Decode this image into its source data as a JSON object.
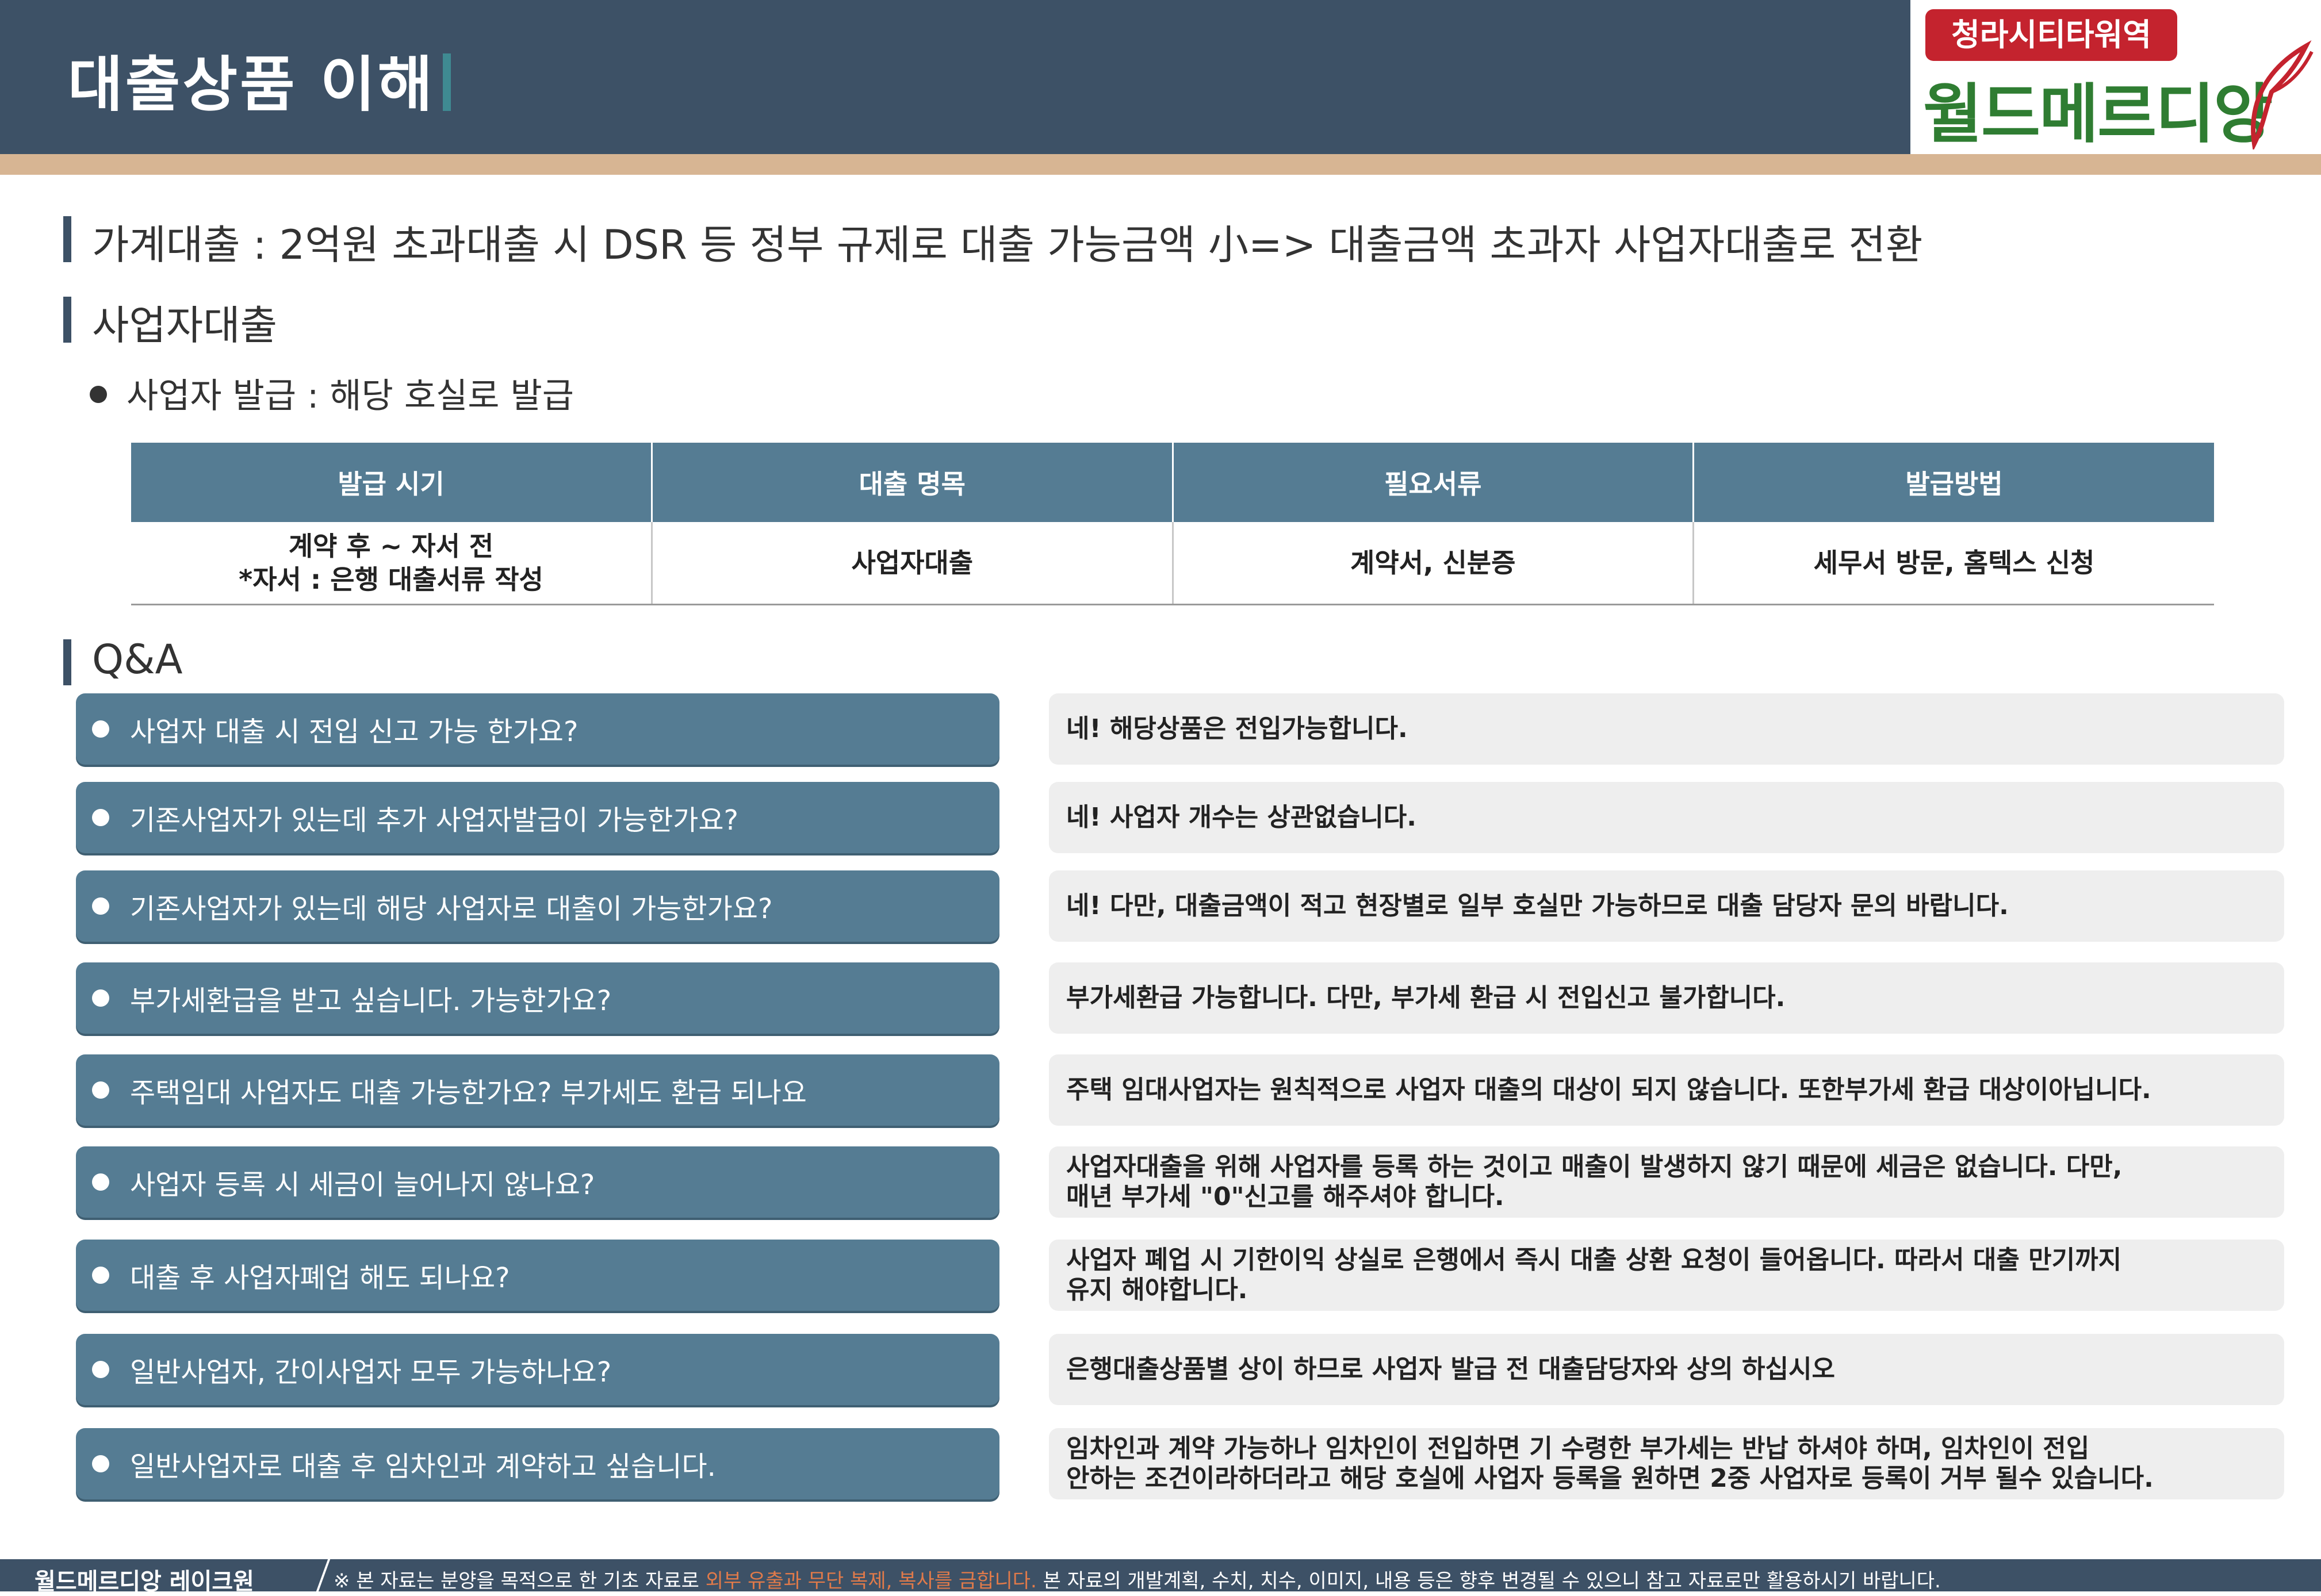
{
  "header": {
    "title": "대출상품 이해",
    "logo_badge": "청라시티타워역",
    "logo_name": "월드메르디앙"
  },
  "sections": {
    "household": "가계대출 : 2억원 초과대출 시 DSR 등 정부 규제로 대출 가능금액 小=> 대출금액 초과자 사업자대출로 전환",
    "business": "사업자대출",
    "business_bullet": "사업자 발급 : 해당 호실로 발급",
    "qa": "Q&A"
  },
  "table": {
    "headers": [
      "발급 시기",
      "대출 명목",
      "필요서류",
      "발급방법"
    ],
    "row": {
      "timing_line1": "계약 후 ~ 자서 전",
      "timing_line2": "*자서 : 은행 대출서류 작성",
      "loan_type": "사업자대출",
      "documents": "계약서, 신분증",
      "method": "세무서 방문, 홈텍스 신청"
    }
  },
  "qa": [
    {
      "q": "사업자 대출 시 전입 신고 가능 한가요?",
      "a": "네! 해당상품은 전입가능합니다."
    },
    {
      "q": "기존사업자가 있는데 추가 사업자발급이 가능한가요?",
      "a": "네! 사업자 개수는 상관없습니다."
    },
    {
      "q": "기존사업자가 있는데 해당 사업자로 대출이 가능한가요?",
      "a": "네! 다만, 대출금액이 적고 현장별로 일부 호실만 가능하므로 대출 담당자 문의 바랍니다."
    },
    {
      "q": "부가세환급을 받고 싶습니다. 가능한가요?",
      "a": "부가세환급 가능합니다. 다만, 부가세 환급 시 전입신고 불가합니다."
    },
    {
      "q": "주택임대 사업자도 대출 가능한가요? 부가세도 환급 되나요",
      "a": "주택 임대사업자는 원칙적으로 사업자 대출의 대상이 되지 않습니다. 또한부가세 환급 대상이아닙니다."
    },
    {
      "q": "사업자 등록 시 세금이 늘어나지 않나요?",
      "a": "사업자대출을 위해 사업자를 등록 하는 것이고 매출이 발생하지 않기 때문에 세금은 없습니다. 다만,\n매년 부가세 \"0\"신고를 해주셔야 합니다."
    },
    {
      "q": "대출 후 사업자폐업 해도 되나요?",
      "a": "사업자 폐업 시 기한이익 상실로 은행에서 즉시 대출 상환 요청이 들어옵니다. 따라서 대출 만기까지\n유지 해야합니다."
    },
    {
      "q": "일반사업자, 간이사업자 모두 가능하나요?",
      "a": "은행대출상품별 상이 하므로 사업자 발급 전 대출담당자와 상의 하십시오"
    },
    {
      "q": "일반사업자로 대출 후 임차인과 계약하고 싶습니다.",
      "a": "임차인과 계약 가능하나 임차인이 전입하면 기 수령한 부가세는 반납 하셔야 하며, 임차인이 전입\n안하는 조건이라하더라고 해당 호실에 사업자 등록을 원하면 2중 사업자로 등록이 거부 될수 있습니다."
    }
  ],
  "footer": {
    "brand": "월드메르디앙 레이크원",
    "notice_start": "※ 본 자료는 분양을 목적으로 한 기초 자료로",
    "notice_warn": "외부 유출과 무단 복제, 복사를 금합니다.",
    "notice_end": "본 자료의 개발계획, 수치, 치수, 이미지, 내용 등은 향후 변경될 수 있으니 참고 자료로만 활용하시기 바랍니다."
  }
}
